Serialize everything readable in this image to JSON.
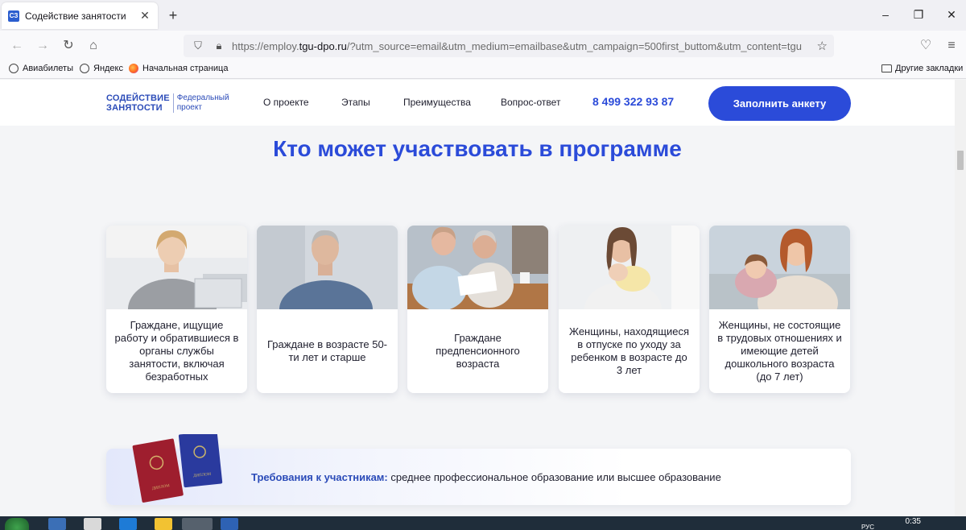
{
  "browser": {
    "tab_title": "Содействие занятости",
    "favicon_text": "СЗ",
    "url_prefix": "https://employ.",
    "url_domain": "tgu-dpo.ru",
    "url_rest": "/?utm_source=email&utm_medium=emailbase&utm_campaign=500first_buttom&utm_content=tgu",
    "bookmarks": [
      "Авиабилеты",
      "Яндекс",
      "Начальная страница"
    ],
    "other_bookmarks": "Другие закладки"
  },
  "site": {
    "logo_line1": "СОДЕЙСТВИЕ",
    "logo_line2": "ЗАНЯТОСТИ",
    "logo_sub1": "Федеральный",
    "logo_sub2": "проект",
    "menu": [
      "О проекте",
      "Этапы",
      "Преимущества",
      "Вопрос-ответ"
    ],
    "phone": "8 499 322 93 87",
    "cta_label": "Заполнить анкету",
    "accent": "#2b4bd9"
  },
  "section": {
    "title": "Кто может участвовать в программе",
    "cards": [
      "Граждане, ищущие работу и обратившиеся в органы службы занятости, включая безработных",
      "Граждане в возрасте 50-ти лет и старше",
      "Граждане предпенсионного возраста",
      "Женщины, находящиеся в отпуске по уходу за ребенком в возрасте до 3 лет",
      "Женщины, не состоящие в трудовых отношениях и имеющие детей дошкольного возраста (до 7 лет)"
    ]
  },
  "requirements": {
    "label": "Требования к участникам:",
    "text": " среднее профессиональное образование или высшее образование",
    "diploma_label": "ДИПЛОМ"
  },
  "taskbar": {
    "time": "0:35",
    "lang": "РУС"
  }
}
